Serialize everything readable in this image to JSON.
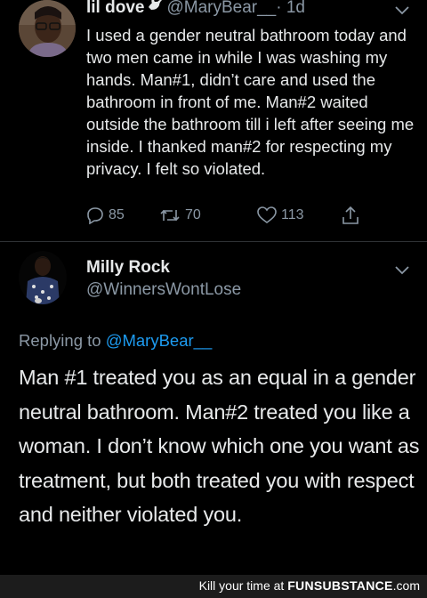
{
  "tweet": {
    "display_name": "lil dove",
    "handle": "@MaryBear__",
    "time": "· 1d",
    "text": "I used a gender neutral bathroom today and two men came in while I was washing my hands. Man#1, didn’t care and used the bathroom in front of me. Man#2 waited outside the bathroom till i left after seeing me inside. I thanked man#2 for respecting my privacy. I felt so violated.",
    "replies": "85",
    "retweets": "70",
    "likes": "113"
  },
  "reply": {
    "display_name": "Milly Rock",
    "handle": "@WinnersWontLose",
    "replying_prefix": "Replying to ",
    "replying_to": "@MaryBear__",
    "text": "Man #1 treated you as an equal in a gender neutral bathroom. Man#2 treated you like a woman. I don’t know which one you want as treatment, but both treated you with respect and neither violated you."
  },
  "watermark": {
    "prefix": "Kill your time at ",
    "brand": "FUNSUBSTANCE",
    "suffix": ".com"
  },
  "icons": {
    "dove": "dove-icon",
    "caret": "chevron-down-icon",
    "reply": "reply-icon",
    "retweet": "retweet-icon",
    "like": "heart-icon",
    "share": "share-icon"
  },
  "colors": {
    "background": "#000000",
    "text": "#e7e9ea",
    "muted": "#8b98a5",
    "link": "#1d9bf0",
    "divider": "#2f3336",
    "footer": "#1c1c1c"
  }
}
